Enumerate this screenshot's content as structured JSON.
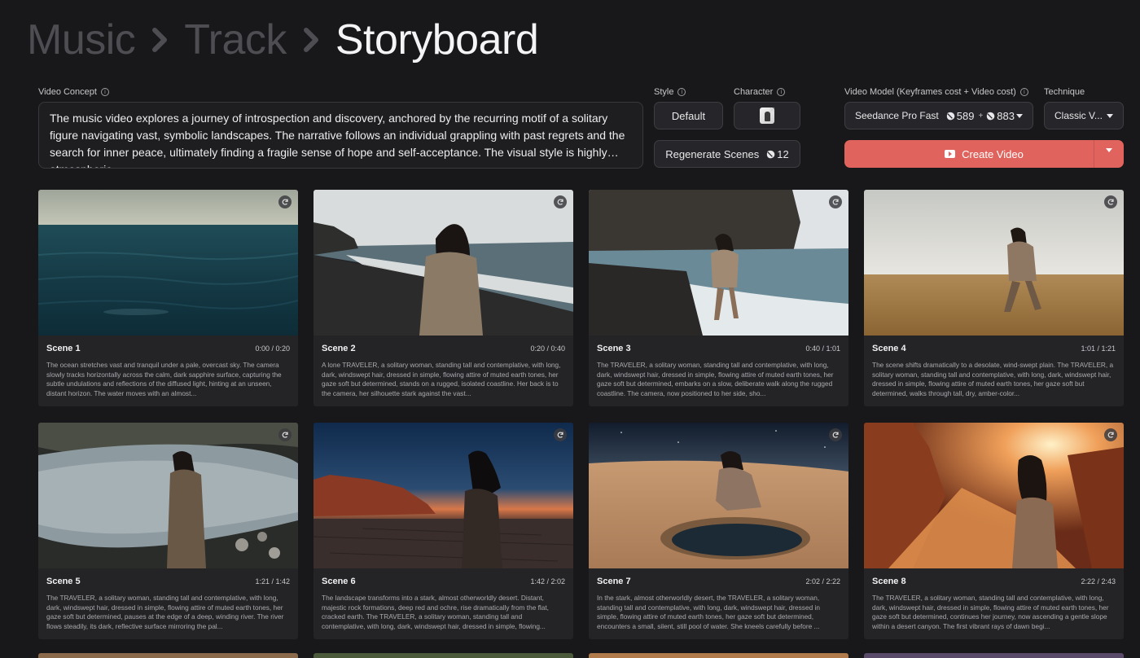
{
  "breadcrumb": {
    "items": [
      "Music",
      "Track",
      "Storyboard"
    ]
  },
  "concept": {
    "label": "Video Concept",
    "text": "The music video explores a journey of introspection and discovery, anchored by the recurring motif of a solitary figure navigating vast, symbolic landscapes. The narrative follows an individual grappling with past regrets and the search for inner peace, ultimately finding a fragile sense of hope and self-acceptance. The visual style is highly atmospheric,..."
  },
  "style": {
    "label": "Style",
    "value": "Default"
  },
  "character": {
    "label": "Character"
  },
  "regenerate": {
    "label": "Regenerate Scenes",
    "cost": "12"
  },
  "model": {
    "label": "Video Model (Keyframes cost + Video cost)",
    "value": "Seedance Pro Fast",
    "keyframe_cost": "589",
    "plus": "+",
    "video_cost": "883"
  },
  "technique": {
    "label": "Technique",
    "value": "Classic V..."
  },
  "create": {
    "label": "Create Video"
  },
  "colors": {
    "accent": "#e0645d",
    "background": "#18181a",
    "card": "#242427"
  },
  "scenes": [
    {
      "title": "Scene 1",
      "time": "0:00 / 0:20",
      "desc": "The ocean stretches vast and tranquil under a pale, overcast sky. The camera slowly tracks horizontally across the calm, dark sapphire surface, capturing the subtle undulations and reflections of the diffused light, hinting at an unseen, distant horizon. The water moves with an almost..."
    },
    {
      "title": "Scene 2",
      "time": "0:20 / 0:40",
      "desc": "A lone TRAVELER, a solitary woman, standing tall and contemplative, with long, dark, windswept hair, dressed in simple, flowing attire of muted earth tones, her gaze soft but determined, stands on a rugged, isolated coastline. Her back is to the camera, her silhouette stark against the vast..."
    },
    {
      "title": "Scene 3",
      "time": "0:40 / 1:01",
      "desc": "The TRAVELER, a solitary woman, standing tall and contemplative, with long, dark, windswept hair, dressed in simple, flowing attire of muted earth tones, her gaze soft but determined, embarks on a slow, deliberate walk along the rugged coastline. The camera, now positioned to her side, sho..."
    },
    {
      "title": "Scene 4",
      "time": "1:01 / 1:21",
      "desc": "The scene shifts dramatically to a desolate, wind-swept plain. The TRAVELER, a solitary woman, standing tall and contemplative, with long, dark, windswept hair, dressed in simple, flowing attire of muted earth tones, her gaze soft but determined, walks through tall, dry, amber-color..."
    },
    {
      "title": "Scene 5",
      "time": "1:21 / 1:42",
      "desc": "The TRAVELER, a solitary woman, standing tall and contemplative, with long, dark, windswept hair, dressed in simple, flowing attire of muted earth tones, her gaze soft but determined, pauses at the edge of a deep, winding river. The river flows steadily, its dark, reflective surface mirroring the pal..."
    },
    {
      "title": "Scene 6",
      "time": "1:42 / 2:02",
      "desc": "The landscape transforms into a stark, almost otherworldly desert. Distant, majestic rock formations, deep red and ochre, rise dramatically from the flat, cracked earth. The TRAVELER, a solitary woman, standing tall and contemplative, with long, dark, windswept hair, dressed in simple, flowing..."
    },
    {
      "title": "Scene 7",
      "time": "2:02 / 2:22",
      "desc": "In the stark, almost otherworldly desert, the TRAVELER, a solitary woman, standing tall and contemplative, with long, dark, windswept hair, dressed in simple, flowing attire of muted earth tones, her gaze soft but determined, encounters a small, silent, still pool of water. She kneels carefully before ..."
    },
    {
      "title": "Scene 8",
      "time": "2:22 / 2:43",
      "desc": "The TRAVELER, a solitary woman, standing tall and contemplative, with long, dark, windswept hair, dressed in simple, flowing attire of muted earth tones, her gaze soft but determined, continues her journey, now ascending a gentle slope within a desert canyon. The first vibrant rays of dawn begi..."
    }
  ]
}
